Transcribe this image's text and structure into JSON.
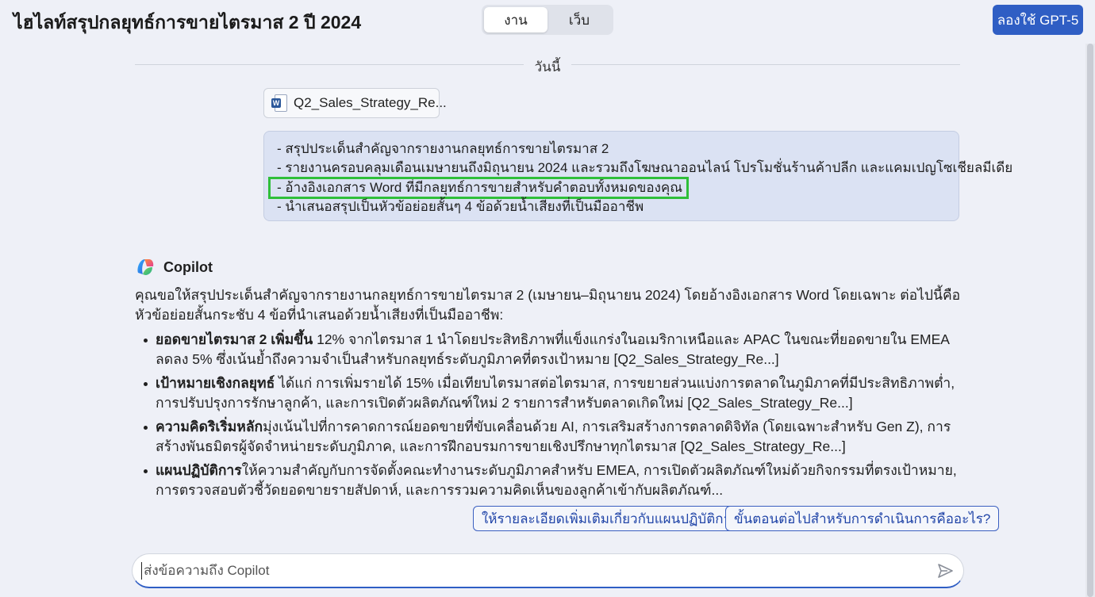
{
  "header": {
    "title": "ไฮไลท์สรุปกลยุทธ์การขายไตรมาส 2 ปี 2024",
    "toggle": [
      "งาน",
      "เว็บ"
    ],
    "try_button": "ลองใช้ GPT-5"
  },
  "divider": {
    "label": "วันนี้"
  },
  "file": {
    "name": "Q2_Sales_Strategy_Re...",
    "icon": "word-document-icon"
  },
  "user_message": {
    "lines": [
      "- สรุปประเด็นสำคัญจากรายงานกลยุทธ์การขายไตรมาส 2",
      "- รายงานครอบคลุมเดือนเมษายนถึงมิถุนายน 2024 และรวมถึงโฆษณาออนไลน์ โปรโมชั่นร้านค้าปลีก และแคมเปญโซเชียลมีเดีย",
      "- อ้างอิงเอกสาร Word ที่มีกลยุทธ์การขายสำหรับคำตอบทั้งหมดของคุณ",
      "- นำเสนอสรุปเป็นหัวข้อย่อยสั้นๆ 4 ข้อด้วยน้ำเสียงที่เป็นมืออาชีพ"
    ]
  },
  "assistant": {
    "name": "Copilot",
    "intro": "คุณขอให้สรุปประเด็นสำคัญจากรายงานกลยุทธ์การขายไตรมาส 2 (เมษายน–มิถุนายน 2024) โดยอ้างอิงเอกสาร Word โดยเฉพาะ ต่อไปนี้คือหัวข้อย่อยสั้นกระชับ 4 ข้อที่นำเสนอด้วยน้ำเสียงที่เป็นมืออาชีพ:",
    "bullets": [
      {
        "bold": "ยอดขายไตรมาส 2 เพิ่มขึ้น",
        "text": " 12% จากไตรมาส 1 นำโดยประสิทธิภาพที่แข็งแกร่งในอเมริกาเหนือและ APAC ในขณะที่ยอดขายใน EMEA ลดลง 5% ซึ่งเน้นย้ำถึงความจำเป็นสำหรับกลยุทธ์ระดับภูมิภาคที่ตรงเป้าหมาย [Q2_Sales_Strategy_Re...]"
      },
      {
        "bold": "เป้าหมายเชิงกลยุทธ์",
        "text": " ได้แก่ การเพิ่มรายได้ 15% เมื่อเทียบไตรมาสต่อไตรมาส, การขยายส่วนแบ่งการตลาดในภูมิภาคที่มีประสิทธิภาพต่ำ, การปรับปรุงการรักษาลูกค้า, และการเปิดตัวผลิตภัณฑ์ใหม่ 2 รายการสำหรับตลาดเกิดใหม่ [Q2_Sales_Strategy_Re...]"
      },
      {
        "bold": "ความคิดริเริ่มหลัก",
        "text": "มุ่งเน้นไปที่การคาดการณ์ยอดขายที่ขับเคลื่อนด้วย AI, การเสริมสร้างการตลาดดิจิทัล (โดยเฉพาะสำหรับ Gen Z), การสร้างพันธมิตรผู้จัดจำหน่ายระดับภูมิภาค, และการฝึกอบรมการขายเชิงปรึกษาทุกไตรมาส [Q2_Sales_Strategy_Re...]"
      },
      {
        "bold": "แผนปฏิบัติการ",
        "text": "ให้ความสำคัญกับการจัดตั้งคณะทำงานระดับภูมิภาคสำหรับ EMEA, การเปิดตัวผลิตภัณฑ์ใหม่ด้วยกิจกรรมที่ตรงเป้าหมาย, การตรวจสอบตัวชี้วัดยอดขายรายสัปดาห์, และการรวมความคิดเห็นของลูกค้าเข้ากับผลิตภัณฑ์..."
      }
    ]
  },
  "suggestions": [
    "ให้รายละเอียดเพิ่มเติมเกี่ยวกับแผนปฏิบัติการ",
    "ขั้นตอนต่อไปสำหรับการดำเนินการคืออะไร?"
  ],
  "composer": {
    "placeholder": "ส่งข้อความถึง Copilot"
  },
  "colors": {
    "accent": "#2f5ec4",
    "highlight": "#2fbf3a",
    "user_bubble": "#dbe2f3"
  }
}
